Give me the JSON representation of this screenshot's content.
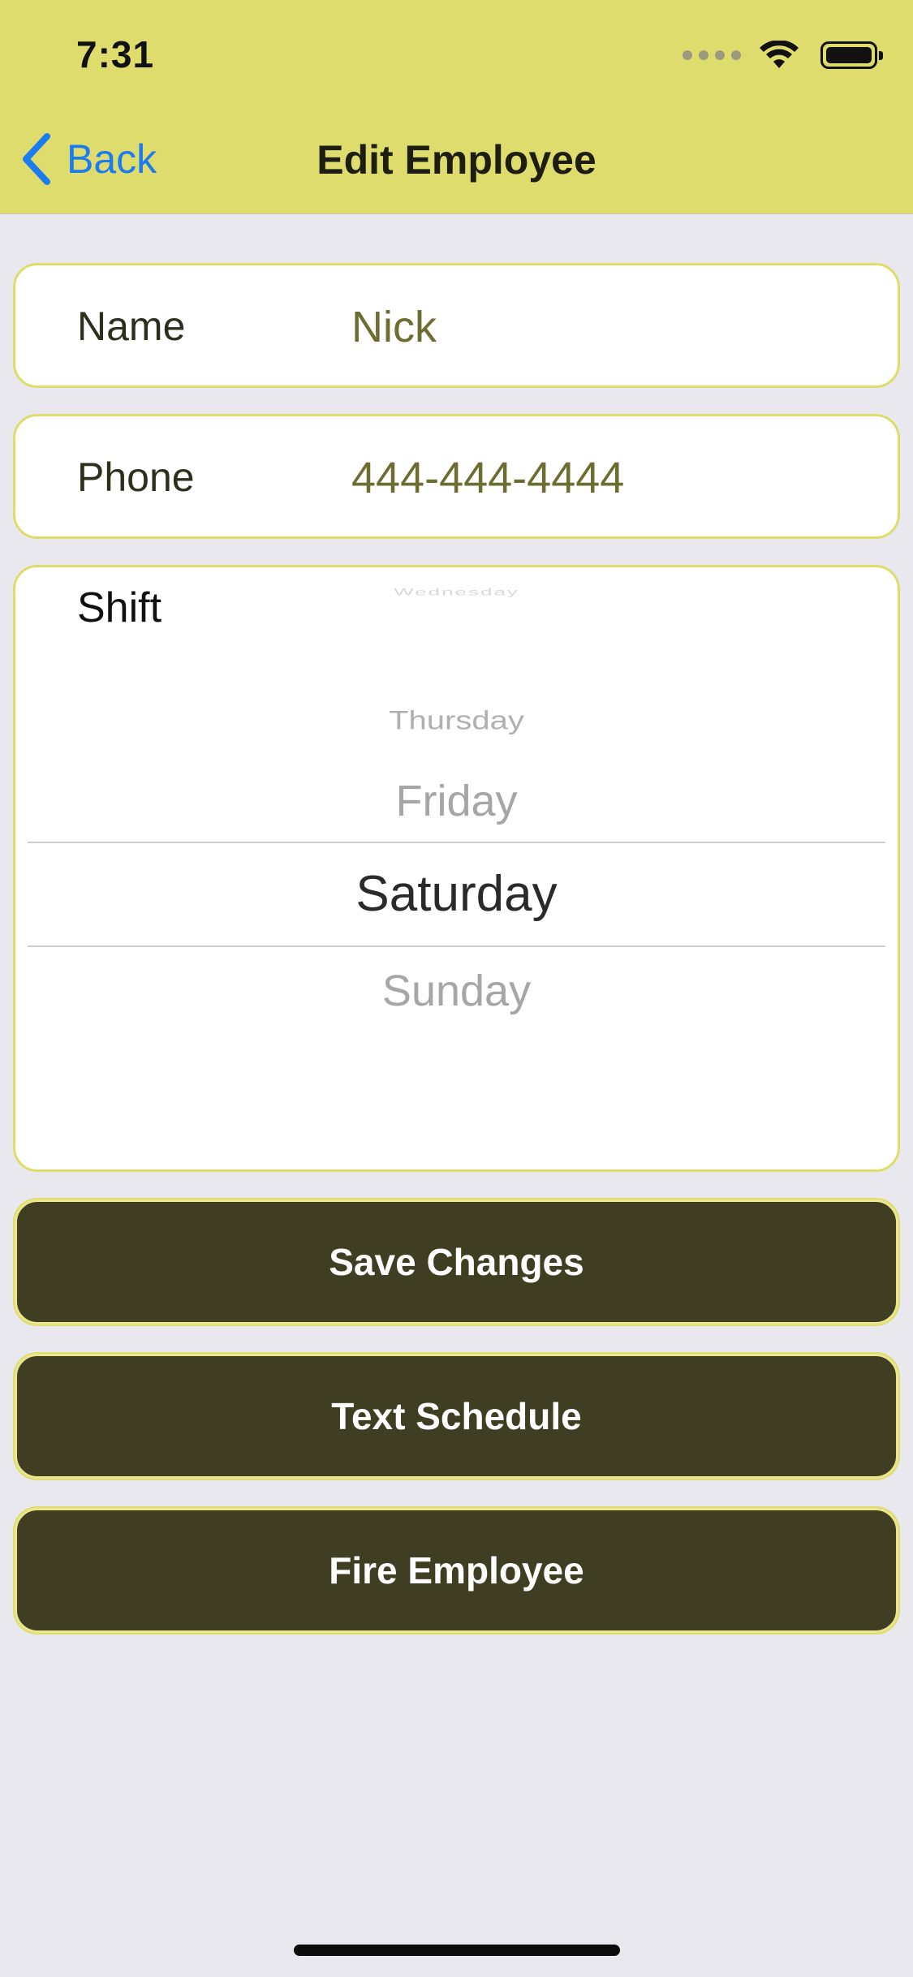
{
  "status_bar": {
    "time": "7:31"
  },
  "nav": {
    "back_label": "Back",
    "title": "Edit Employee"
  },
  "form": {
    "name": {
      "label": "Name",
      "value": "Nick"
    },
    "phone": {
      "label": "Phone",
      "value": "444-444-4444"
    },
    "shift": {
      "label": "Shift",
      "options_visible": [
        "Wednesday",
        "Thursday",
        "Friday",
        "Saturday",
        "Sunday"
      ],
      "selected": "Saturday"
    }
  },
  "actions": {
    "save_label": "Save Changes",
    "text_label": "Text Schedule",
    "fire_label": "Fire Employee"
  },
  "colors": {
    "header_bg": "#dfdc6e",
    "accent": "#1a7cf0",
    "button_bg": "#403e22",
    "card_border": "#dedd6a",
    "page_bg": "#e9e8ef"
  },
  "icons": {
    "back": "chevron-left-icon",
    "signal": "cellular-signal-icon",
    "wifi": "wifi-icon",
    "battery": "battery-icon"
  }
}
